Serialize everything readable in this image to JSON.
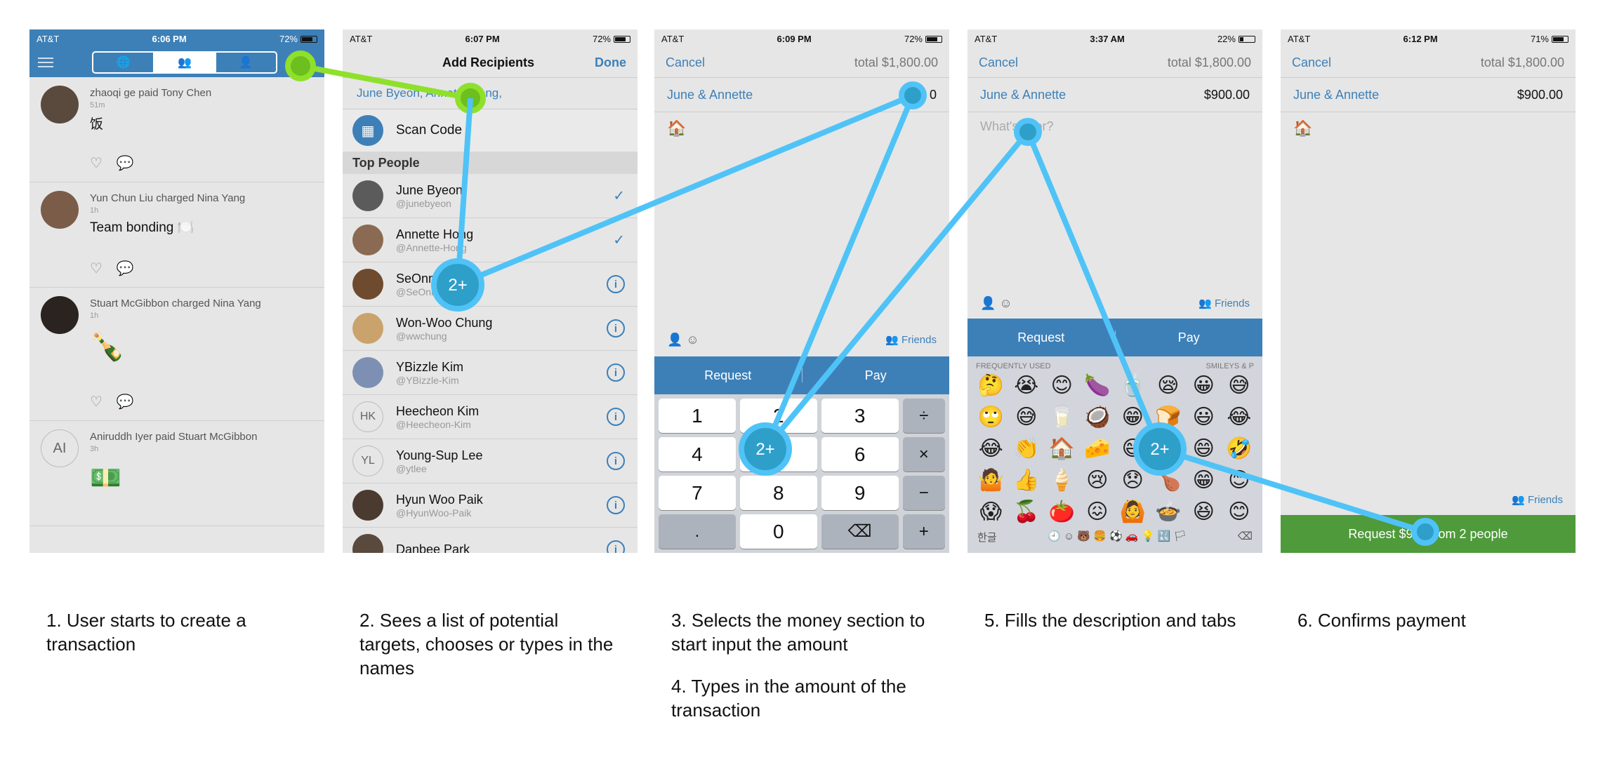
{
  "status": {
    "carrier": "AT&T",
    "p1_time": "6:06 PM",
    "p1_batt": "72%",
    "p2_time": "6:07 PM",
    "p2_batt": "72%",
    "p3_time": "6:09 PM",
    "p3_batt": "72%",
    "p4_time": "3:37 AM",
    "p4_batt": "22%",
    "p5_time": "6:12 PM",
    "p5_batt": "71%"
  },
  "feed": [
    {
      "title": "zhaoqi ge paid Tony Chen",
      "meta": "51m",
      "note": "饭"
    },
    {
      "title": "Yun Chun Liu charged Nina Yang",
      "meta": "1h",
      "note": "Team bonding 🍽️"
    },
    {
      "title": "Stuart McGibbon charged Nina Yang",
      "meta": "1h",
      "note": "🍾"
    },
    {
      "title": "Aniruddh Iyer paid Stuart McGibbon",
      "meta": "3h",
      "note": "💵",
      "initials": "AI"
    }
  ],
  "recipients": {
    "title": "Add Recipients",
    "done": "Done",
    "selected": "June Byeon, Annette Hong,",
    "scan": "Scan Code",
    "section": "Top People",
    "people": [
      {
        "name": "June Byeon",
        "user": "@junebyeon",
        "checked": true
      },
      {
        "name": "Annette Hong",
        "user": "@Annette-Hong",
        "checked": true
      },
      {
        "name": "SeOnna",
        "user": "@SeOnna",
        "checked": false
      },
      {
        "name": "Won-Woo Chung",
        "user": "@wwchung",
        "checked": false
      },
      {
        "name": "YBizzle Kim",
        "user": "@YBizzle-Kim",
        "checked": false
      },
      {
        "name": "Heecheon Kim",
        "user": "@Heecheon-Kim",
        "checked": false,
        "initials": "HK"
      },
      {
        "name": "Young-Sup Lee",
        "user": "@ytlee",
        "checked": false,
        "initials": "YL"
      },
      {
        "name": "Hyun Woo Paik",
        "user": "@HyunWoo-Paik",
        "checked": false
      },
      {
        "name": "Danbee Park",
        "user": "",
        "checked": false
      }
    ]
  },
  "payment": {
    "cancel": "Cancel",
    "total": "total $1,800.00",
    "who": "June & Annette",
    "amount": "$900.00",
    "amount_partial": "0",
    "note_emoji": "🏠",
    "desc_placeholder": "What's it for?",
    "friends": "Friends",
    "request": "Request",
    "pay": "Pay",
    "confirm": "Request $900 from 2 people"
  },
  "keypad": [
    "1",
    "2",
    "3",
    "÷",
    "4",
    "5",
    "6",
    "×",
    "7",
    "8",
    "9",
    "−",
    ".",
    "0",
    "⌫",
    "+"
  ],
  "emoji_kb": {
    "frequent": "FREQUENTLY USED",
    "smileys": "SMILEYS & P",
    "lang": "한글",
    "emojis": [
      "🤔",
      "😭",
      "😊",
      "🍆",
      "🍵",
      "😪",
      "😀",
      "😅",
      "🙄",
      "😅",
      "🥛",
      "🥥",
      "😁",
      "🍞",
      "😃",
      "😂",
      "😂",
      "👏",
      "🏠",
      "🧀",
      "😄",
      "😐",
      "😄",
      "🤣",
      "🤷",
      "👍",
      "🍦",
      "😢",
      "😞",
      "🍗",
      "😁",
      "😊",
      "😱",
      "🍒",
      "🍅",
      "😖",
      "🙆",
      "🍲",
      "😆",
      "😊"
    ]
  },
  "captions": {
    "c1": "1. User starts to create a transaction",
    "c2": "2. Sees a list of potential targets, chooses or types in the names",
    "c3": "3. Selects the money section to start input the amount",
    "c4": "4. Types in the amount of the transaction",
    "c5": "5. Fills the description and tabs",
    "c6": "6. Confirms payment"
  },
  "badge": "2+",
  "colors": {
    "accent": "#3d80b8",
    "green_path": "#8fe02a",
    "blue_path": "#4fc3f7",
    "confirm": "#4f9a3b"
  }
}
